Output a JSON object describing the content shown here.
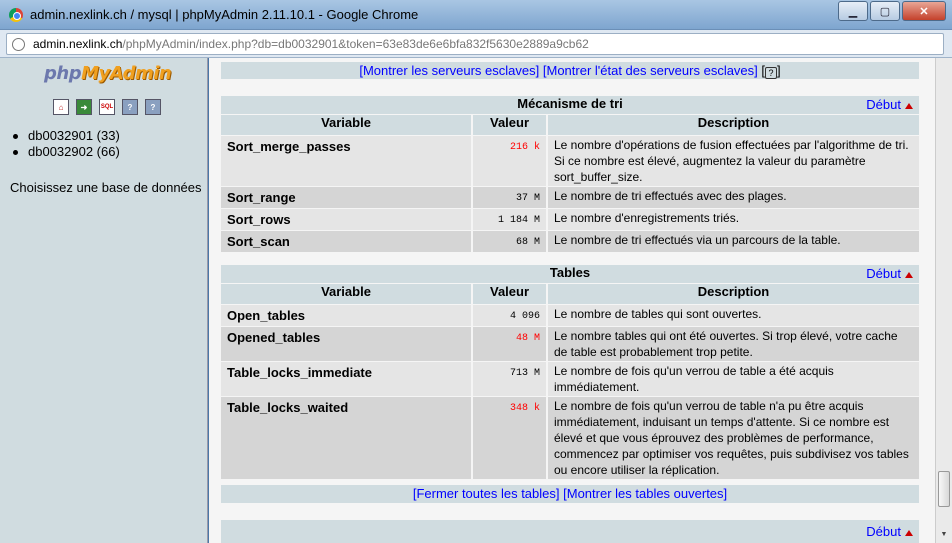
{
  "window": {
    "title": "admin.nexlink.ch / mysql | phpMyAdmin 2.11.10.1 - Google Chrome",
    "buttons": {
      "minimize": "▁",
      "maximize": "▢",
      "close": "✕"
    }
  },
  "urlbar": {
    "host": "admin.nexlink.ch",
    "path": "/phpMyAdmin/index.php?db=db0032901&token=63e83de6e6bfa832f5630e2889a9cb62"
  },
  "sidebar": {
    "logo_php": "php",
    "logo_myadmin": "MyAdmin",
    "icons": [
      "home-icon",
      "exit-icon",
      "sql-icon",
      "docs-icon",
      "help-icon"
    ],
    "databases": [
      {
        "label": "db0032901 (33)"
      },
      {
        "label": "db0032902 (66)"
      }
    ],
    "choose_label": "Choisissez une base de données"
  },
  "main": {
    "top_links": {
      "slaves_servers": "[Montrer les serveurs esclaves]",
      "slaves_status": "[Montrer l'état des serveurs esclaves]",
      "help_open": "[",
      "help_glyph": "?",
      "help_close": "]"
    },
    "debut_label": "Début",
    "columns": {
      "variable": "Variable",
      "value": "Valeur",
      "description": "Description"
    },
    "sort_section": {
      "title": "Mécanisme de tri",
      "rows": [
        {
          "variable": "Sort_merge_passes",
          "value": "216 k",
          "alert": true,
          "description": "Le nombre d'opérations de fusion effectuées par l'algorithme de tri. Si ce nombre est élevé, augmentez la valeur du paramètre sort_buffer_size."
        },
        {
          "variable": "Sort_range",
          "value": "37 M",
          "alert": false,
          "description": "Le nombre de tri effectués avec des plages."
        },
        {
          "variable": "Sort_rows",
          "value": "1 184 M",
          "alert": false,
          "description": "Le nombre d'enregistrements triés."
        },
        {
          "variable": "Sort_scan",
          "value": "68 M",
          "alert": false,
          "description": "Le nombre de tri effectués via un parcours de la table."
        }
      ]
    },
    "tables_section": {
      "title": "Tables",
      "rows": [
        {
          "variable": "Open_tables",
          "value": "4 096",
          "alert": false,
          "description": "Le nombre de tables qui sont ouvertes."
        },
        {
          "variable": "Opened_tables",
          "value": "48 M",
          "alert": true,
          "description": "Le nombre tables qui ont été ouvertes. Si trop élevé, votre cache de table est probablement trop petite."
        },
        {
          "variable": "Table_locks_immediate",
          "value": "713 M",
          "alert": false,
          "description": "Le nombre de fois qu'un verrou de table a été acquis immédiatement."
        },
        {
          "variable": "Table_locks_waited",
          "value": "348 k",
          "alert": true,
          "description": "Le nombre de fois qu'un verrou de table n'a pu être acquis immédiatement, induisant un temps d'attente. Si ce nombre est élevé et que vous éprouvez des problèmes de performance, commencez par optimiser vos requêtes, puis subdivisez vos tables ou encore utiliser la réplication."
        }
      ]
    },
    "bottom_links": {
      "close_tables": "[Fermer toutes les tables]",
      "show_open_tables": "[Montrer les tables ouvertes]"
    }
  }
}
